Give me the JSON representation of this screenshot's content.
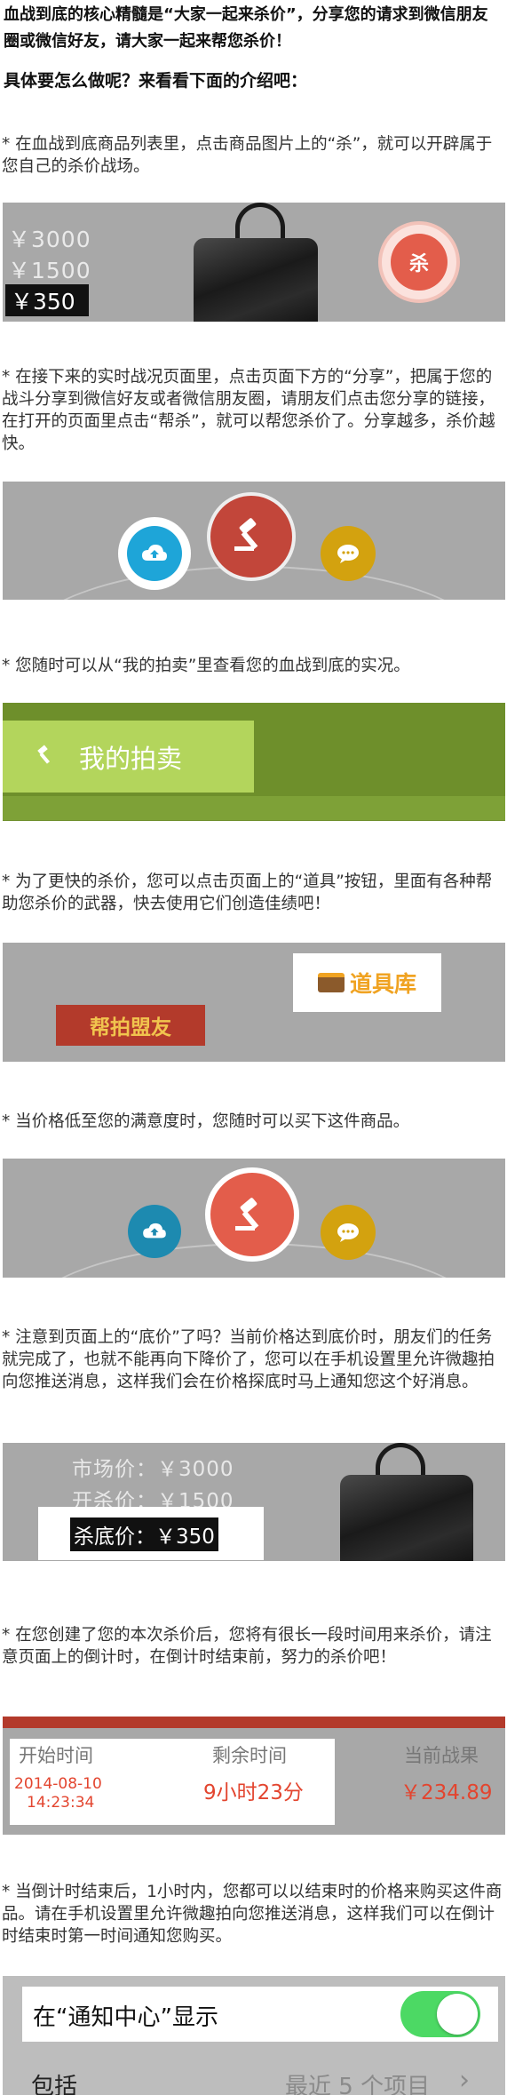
{
  "intro": {
    "line1": "血战到底的核心精髓是“大家一起来杀价”，分享您的请求到微信朋友圈或微信好友，请大家一起来帮您杀价！",
    "line2": "具体要怎么做呢？来看看下面的介绍吧："
  },
  "steps": [
    {
      "text": "* 在血战到底商品列表里，点击商品图片上的“杀”，就可以开辟属于您自己的杀价战场。"
    },
    {
      "text": "* 在接下来的实时战况页面里，点击页面下方的“分享”，把属于您的战斗分享到微信好友或者微信朋友圈，请朋友们点击您分享的链接，在打开的页面里点击“帮杀”，就可以帮您杀价了。分享越多，杀价越快。"
    },
    {
      "text": "* 您随时可以从“我的拍卖”里查看您的血战到底的实况。"
    },
    {
      "text": "* 为了更快的杀价，您可以点击页面上的“道具”按钮，里面有各种帮助您杀价的武器，快去使用它们创造佳绩吧！"
    },
    {
      "text": "* 当价格低至您的满意度时，您随时可以买下这件商品。"
    },
    {
      "text": "* 注意到页面上的“底价”了吗？当前价格达到底价时，朋友们的任务就完成了，也就不能再向下降价了，您可以在手机设置里允许微趣拍向您推送消息，这样我们会在价格探底时马上通知您这个好消息。"
    },
    {
      "text": "* 在您创建了您的本次杀价后，您将有很长一段时间用来杀价，请注意页面上的倒计时，在倒计时结束前，努力的杀价吧！"
    },
    {
      "text": "* 当倒计时结束后，1小时内，您都可以以结束时的价格来购买这件商品。请在手机设置里允许微趣拍向您推送消息，这样我们可以在倒计时结束时第一时间通知您购买。"
    }
  ],
  "panel1": {
    "price_a": "￥3000",
    "price_b": "￥1500",
    "price_c": "￥350",
    "kill_label": "杀"
  },
  "panel3": {
    "my_auction": "我的拍卖"
  },
  "panel4": {
    "ribbon": "帮拍盟友",
    "toolbox": "道具库"
  },
  "panel6": {
    "market": "市场价：￥3000",
    "start": "开杀价：￥1500",
    "floor": "杀底价：￥350"
  },
  "panel7": {
    "start_label": "开始时间",
    "start_date": "2014-08-10",
    "start_time": "14:23:34",
    "remain_label": "剩余时间",
    "remain_val": "9小时23分",
    "current_label": "当前战果",
    "current_val": "￥234.89"
  },
  "panel8": {
    "notify_label": "在“通知中心”显示",
    "include_label": "包括",
    "recent_label": "最近 5 个项目"
  },
  "colors": {
    "panel_gray": "#a8a8a8",
    "kill_red": "#e35d4b",
    "share_blue": "#1ea5d8",
    "hammer_red": "#c2463a",
    "chat_gold": "#d3a20f",
    "green_dark": "#6e8f2b",
    "green_light": "#b3d55c",
    "toggle_green": "#4cd964"
  },
  "icons": [
    "bag-image",
    "kill-icon",
    "cloud-upload-icon",
    "hammer-icon",
    "chat-icon",
    "toolbox-icon",
    "toggle-switch",
    "chevron-right-icon"
  ]
}
